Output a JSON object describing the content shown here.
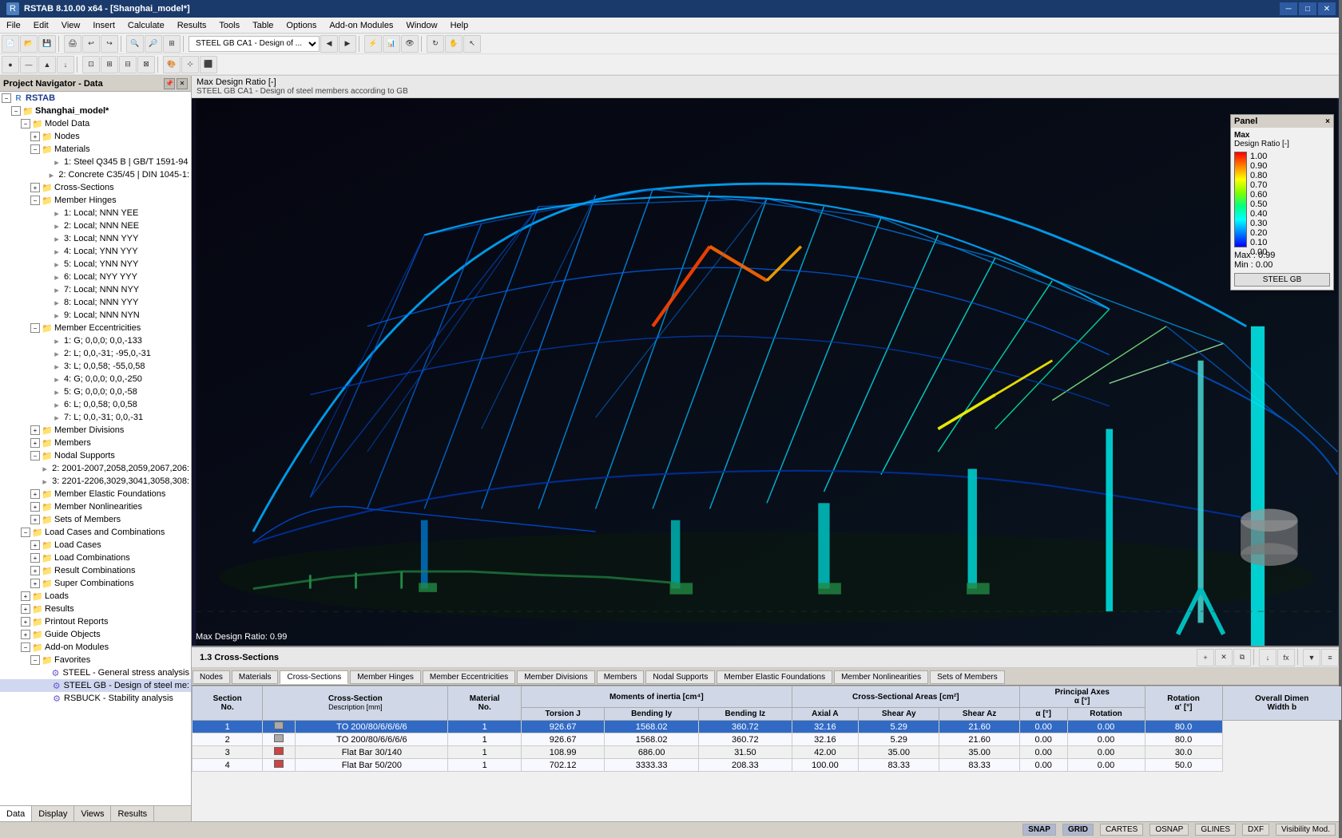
{
  "titlebar": {
    "title": "RSTAB 8.10.00 x64 - [Shanghai_model*]",
    "icon": "R"
  },
  "menubar": {
    "items": [
      "File",
      "Edit",
      "View",
      "Insert",
      "Calculate",
      "Results",
      "Tools",
      "Table",
      "Options",
      "Add-on Modules",
      "Window",
      "Help"
    ]
  },
  "viewport": {
    "header_line1": "Max Design Ratio [-]",
    "header_line2": "STEEL GB CA1 - Design of steel members according to GB",
    "ratio_label": "Max Design Ratio: 0.99"
  },
  "panel": {
    "title": "Panel",
    "close": "×",
    "label_max": "Max",
    "label_design_ratio": "Design Ratio [-]",
    "legend_values": [
      "1.00",
      "0.90",
      "0.80",
      "0.70",
      "0.60",
      "0.50",
      "0.40",
      "0.30",
      "0.20",
      "0.10",
      "0.00"
    ],
    "max_label": "Max :",
    "max_value": "0.99",
    "min_label": "Min :",
    "min_value": "0.00",
    "button_label": "STEEL GB"
  },
  "navigator": {
    "title": "Project Navigator - Data",
    "tabs": [
      "Data",
      "Display",
      "Views",
      "Results"
    ],
    "tree": [
      {
        "id": "rstab",
        "label": "RSTAB",
        "level": 0,
        "type": "root",
        "expanded": true
      },
      {
        "id": "shanghai",
        "label": "Shanghai_model*",
        "level": 1,
        "type": "folder",
        "expanded": true
      },
      {
        "id": "model-data",
        "label": "Model Data",
        "level": 2,
        "type": "folder",
        "expanded": true
      },
      {
        "id": "nodes",
        "label": "Nodes",
        "level": 3,
        "type": "folder",
        "expanded": false
      },
      {
        "id": "materials",
        "label": "Materials",
        "level": 3,
        "type": "folder",
        "expanded": true
      },
      {
        "id": "mat1",
        "label": "1: Steel Q345 B | GB/T 1591-94",
        "level": 4,
        "type": "item"
      },
      {
        "id": "mat2",
        "label": "2: Concrete C35/45 | DIN 1045-1:",
        "level": 4,
        "type": "item"
      },
      {
        "id": "cross-sections",
        "label": "Cross-Sections",
        "level": 3,
        "type": "folder",
        "expanded": false
      },
      {
        "id": "member-hinges",
        "label": "Member Hinges",
        "level": 3,
        "type": "folder",
        "expanded": true
      },
      {
        "id": "hinge1",
        "label": "1: Local; NNN YEE",
        "level": 4,
        "type": "item"
      },
      {
        "id": "hinge2",
        "label": "2: Local; NNN NEE",
        "level": 4,
        "type": "item"
      },
      {
        "id": "hinge3",
        "label": "3: Local; NNN YYY",
        "level": 4,
        "type": "item"
      },
      {
        "id": "hinge4",
        "label": "4: Local; YNN YYY",
        "level": 4,
        "type": "item"
      },
      {
        "id": "hinge5",
        "label": "5: Local; YNN NYY",
        "level": 4,
        "type": "item"
      },
      {
        "id": "hinge6",
        "label": "6: Local; NYY YYY",
        "level": 4,
        "type": "item"
      },
      {
        "id": "hinge7",
        "label": "7: Local; NNN NYY",
        "level": 4,
        "type": "item"
      },
      {
        "id": "hinge8",
        "label": "8: Local; NNN YYY",
        "level": 4,
        "type": "item"
      },
      {
        "id": "hinge9",
        "label": "9: Local; NNN NYN",
        "level": 4,
        "type": "item"
      },
      {
        "id": "member-ecc",
        "label": "Member Eccentricities",
        "level": 3,
        "type": "folder",
        "expanded": true
      },
      {
        "id": "ecc1",
        "label": "1: G; 0,0,0; 0,0,-133",
        "level": 4,
        "type": "item"
      },
      {
        "id": "ecc2",
        "label": "2: L; 0,0,-31; -95,0,-31",
        "level": 4,
        "type": "item"
      },
      {
        "id": "ecc3",
        "label": "3: L; 0,0,58; -55,0,58",
        "level": 4,
        "type": "item"
      },
      {
        "id": "ecc4",
        "label": "4: G; 0,0,0; 0,0,-250",
        "level": 4,
        "type": "item"
      },
      {
        "id": "ecc5",
        "label": "5: G; 0,0,0; 0,0,-58",
        "level": 4,
        "type": "item"
      },
      {
        "id": "ecc6",
        "label": "6: L; 0,0,58; 0,0,58",
        "level": 4,
        "type": "item"
      },
      {
        "id": "ecc7",
        "label": "7: L; 0,0,-31; 0,0,-31",
        "level": 4,
        "type": "item"
      },
      {
        "id": "member-div",
        "label": "Member Divisions",
        "level": 3,
        "type": "folder",
        "expanded": false
      },
      {
        "id": "members",
        "label": "Members",
        "level": 3,
        "type": "folder",
        "expanded": false
      },
      {
        "id": "nodal-sup",
        "label": "Nodal Supports",
        "level": 3,
        "type": "folder",
        "expanded": true
      },
      {
        "id": "sup1",
        "label": "2: 2001-2007,2058,2059,2067,206:",
        "level": 4,
        "type": "item"
      },
      {
        "id": "sup2",
        "label": "3: 2201-2206,3029,3041,3058,308:",
        "level": 4,
        "type": "item"
      },
      {
        "id": "mem-elastic",
        "label": "Member Elastic Foundations",
        "level": 3,
        "type": "folder",
        "expanded": false
      },
      {
        "id": "mem-nonlin",
        "label": "Member Nonlinearities",
        "level": 3,
        "type": "folder",
        "expanded": false
      },
      {
        "id": "sets-members",
        "label": "Sets of Members",
        "level": 3,
        "type": "folder",
        "expanded": false
      },
      {
        "id": "load-cases-comb",
        "label": "Load Cases and Combinations",
        "level": 2,
        "type": "folder",
        "expanded": true
      },
      {
        "id": "load-cases",
        "label": "Load Cases",
        "level": 3,
        "type": "folder",
        "expanded": false
      },
      {
        "id": "load-comb",
        "label": "Load Combinations",
        "level": 3,
        "type": "folder",
        "expanded": false
      },
      {
        "id": "result-comb",
        "label": "Result Combinations",
        "level": 3,
        "type": "folder",
        "expanded": false
      },
      {
        "id": "super-comb",
        "label": "Super Combinations",
        "level": 3,
        "type": "folder",
        "expanded": false
      },
      {
        "id": "loads",
        "label": "Loads",
        "level": 2,
        "type": "folder",
        "expanded": false
      },
      {
        "id": "results",
        "label": "Results",
        "level": 2,
        "type": "folder",
        "expanded": false
      },
      {
        "id": "printout",
        "label": "Printout Reports",
        "level": 2,
        "type": "folder",
        "expanded": false
      },
      {
        "id": "guide-obj",
        "label": "Guide Objects",
        "level": 2,
        "type": "folder",
        "expanded": false
      },
      {
        "id": "addon",
        "label": "Add-on Modules",
        "level": 2,
        "type": "folder",
        "expanded": true
      },
      {
        "id": "favorites",
        "label": "Favorites",
        "level": 3,
        "type": "folder",
        "expanded": true
      },
      {
        "id": "steel-gen",
        "label": "STEEL - General stress analysis",
        "level": 4,
        "type": "item-special"
      },
      {
        "id": "steel-gb",
        "label": "STEEL GB - Design of steel me:",
        "level": 4,
        "type": "item-special"
      },
      {
        "id": "rsbuck",
        "label": "RSBUCK - Stability analysis",
        "level": 4,
        "type": "item-special"
      }
    ]
  },
  "table": {
    "section_label": "1.3 Cross-Sections",
    "column_headers": [
      {
        "key": "section_no",
        "label": "Section No.",
        "sub": ""
      },
      {
        "key": "cross_section",
        "label": "Cross-Section",
        "sub": "Description [mm]"
      },
      {
        "key": "material_no",
        "label": "Material No.",
        "sub": ""
      },
      {
        "key": "torsion_j",
        "label": "Torsion J",
        "sub": ""
      },
      {
        "key": "bending_iy",
        "label": "Bending Iy",
        "sub": ""
      },
      {
        "key": "bending_iz",
        "label": "Bending Iz",
        "sub": ""
      },
      {
        "key": "axial_a",
        "label": "Axial A",
        "sub": ""
      },
      {
        "key": "shear_ay",
        "label": "Shear Ay",
        "sub": ""
      },
      {
        "key": "shear_az",
        "label": "Shear Az",
        "sub": ""
      },
      {
        "key": "alpha",
        "label": "α [°]",
        "sub": ""
      },
      {
        "key": "rotation",
        "label": "Rotation α' [°]",
        "sub": ""
      },
      {
        "key": "width_b",
        "label": "Overall Dimen Width b",
        "sub": ""
      }
    ],
    "col_group_moments": "Moments of inertia [cm⁴]",
    "col_group_areas": "Cross-Sectional Areas [cm²]",
    "col_group_principal": "Principal Axes",
    "rows": [
      {
        "no": 1,
        "description": "TO 200/80/6/6/6/6",
        "mat": 1,
        "torsion": "926.67",
        "biy": "1568.02",
        "biz": "360.72",
        "axial": "32.16",
        "shear_ay": "5.29",
        "shear_az": "21.60",
        "alpha": "0.00",
        "rotation": "0.00",
        "width": "80.0",
        "selected": true
      },
      {
        "no": 2,
        "description": "TO 200/80/6/6/6/6",
        "mat": 1,
        "torsion": "926.67",
        "biy": "1568.02",
        "biz": "360.72",
        "axial": "32.16",
        "shear_ay": "5.29",
        "shear_az": "21.60",
        "alpha": "0.00",
        "rotation": "0.00",
        "width": "80.0"
      },
      {
        "no": 3,
        "description": "Flat Bar 30/140",
        "mat": 1,
        "torsion": "108.99",
        "biy": "686.00",
        "biz": "31.50",
        "axial": "42.00",
        "shear_ay": "35.00",
        "shear_az": "35.00",
        "alpha": "0.00",
        "rotation": "0.00",
        "width": "30.0"
      },
      {
        "no": 4,
        "description": "Flat Bar 50/200",
        "mat": 1,
        "torsion": "702.12",
        "biy": "3333.33",
        "biz": "208.33",
        "axial": "100.00",
        "shear_ay": "83.33",
        "shear_az": "83.33",
        "alpha": "0.00",
        "rotation": "0.00",
        "width": "50.0"
      }
    ]
  },
  "bottom_tabs": [
    "Nodes",
    "Materials",
    "Cross-Sections",
    "Member Hinges",
    "Member Eccentricities",
    "Member Divisions",
    "Members",
    "Nodal Supports",
    "Member Elastic Foundations",
    "Member Nonlinearities",
    "Sets of Members"
  ],
  "active_bottom_tab": "Cross-Sections",
  "statusbar": {
    "items": [
      "SNAP",
      "GRID",
      "CARTES",
      "OSNAP",
      "GLINES",
      "DXF",
      "Visibility Mod."
    ]
  }
}
